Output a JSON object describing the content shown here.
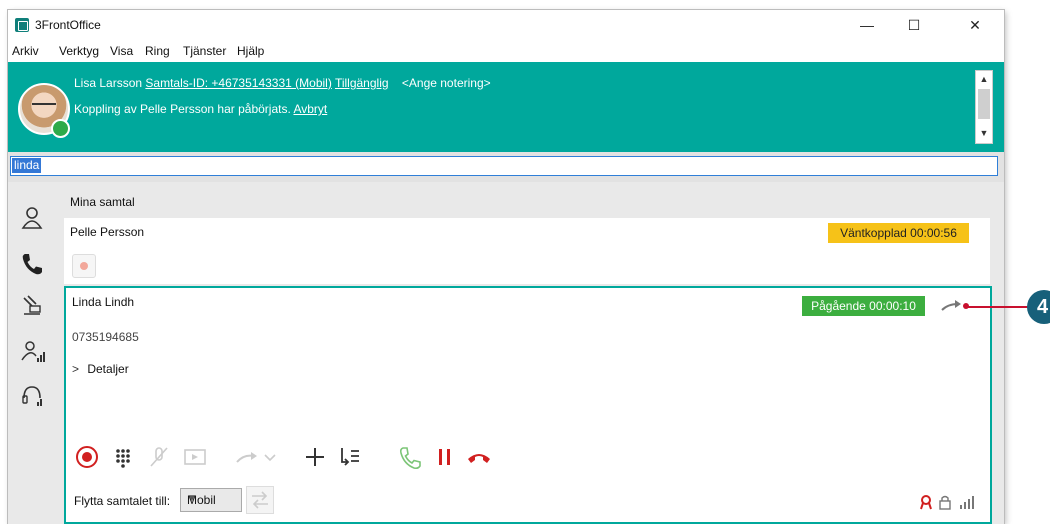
{
  "window": {
    "title": "3FrontOffice",
    "controls": {
      "minimize": "—",
      "maximize": "☐",
      "close": "✕"
    }
  },
  "menu": [
    "Arkiv",
    "Verktyg",
    "Visa",
    "Ring",
    "Tjänster",
    "Hjälp"
  ],
  "infobar": {
    "user_name": "Lisa Larsson",
    "caller_id_link": "Samtals-ID: +46735143331 (Mobil)",
    "availability_link": "Tillgänglig",
    "note_placeholder": "<Ange notering>",
    "transfer_message": "Koppling av Pelle Persson har påbörjats.",
    "cancel_link": "Avbryt",
    "accent_color": "#00a89c"
  },
  "search": {
    "value": "linda"
  },
  "sidebar": {
    "icons": [
      "contacts-icon",
      "phone-icon",
      "queue-icon",
      "groups-icon",
      "headset-icon"
    ]
  },
  "main": {
    "section_title": "Mina samtal",
    "calls": [
      {
        "name": "Pelle Persson",
        "status": "Väntkopplad 00:00:56",
        "status_color": "#f6c218"
      },
      {
        "name": "Linda Lindh",
        "status": "Pågående 00:00:10",
        "status_color": "#3cae3f",
        "number": "0735194685",
        "details_label": "Detaljer",
        "move_label": "Flytta samtalet till:",
        "move_selected": "Mobil"
      }
    ]
  },
  "callout": {
    "number": "4",
    "color": "#c8102e",
    "badge_color": "#17607a"
  }
}
